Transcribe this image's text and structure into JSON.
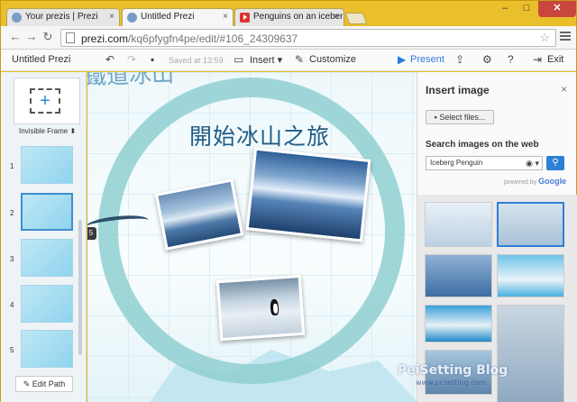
{
  "browser": {
    "tabs": [
      {
        "label": "Your prezis | Prezi",
        "icon": "prezi-tab-icon"
      },
      {
        "label": "Untitled Prezi",
        "icon": "prezi-tab-icon"
      },
      {
        "label": "Penguins on an iceberg",
        "icon": "youtube-icon"
      }
    ],
    "url_prefix": "prezi.com",
    "url_path": "/kq6pfygfn4pe/edit/#106_24309637",
    "window_controls": {
      "min": "–",
      "max": "□",
      "close": "✕"
    }
  },
  "prezi_bar": {
    "title": "Untitled Prezi",
    "saved": "Saved at 13:59",
    "insert": "Insert",
    "customize": "Customize",
    "present": "Present",
    "exit": "Exit"
  },
  "sidebar": {
    "add_icon": "+",
    "frame_type": "Invisible Frame",
    "thumbs": [
      "1",
      "2",
      "3",
      "4",
      "5"
    ],
    "edit_path": "Edit Path"
  },
  "canvas": {
    "heading": "開始冰山之旅",
    "top_text": "鐵道冰山",
    "path_marker": "5"
  },
  "insert_panel": {
    "title": "Insert image",
    "close": "×",
    "select_files": "Select files...",
    "search_heading": "Search images on the web",
    "search_value": "Iceberg Penguin",
    "powered_by": "powered by",
    "provider": "Google"
  },
  "watermark": {
    "main": "PeiSetting Blog",
    "sub": "www.pcsetting.com"
  },
  "colors": {
    "accent": "#2e7fd7",
    "ring": "#8fcfd1",
    "heading": "#215b86",
    "chrome_frame": "#e9bf2b"
  }
}
